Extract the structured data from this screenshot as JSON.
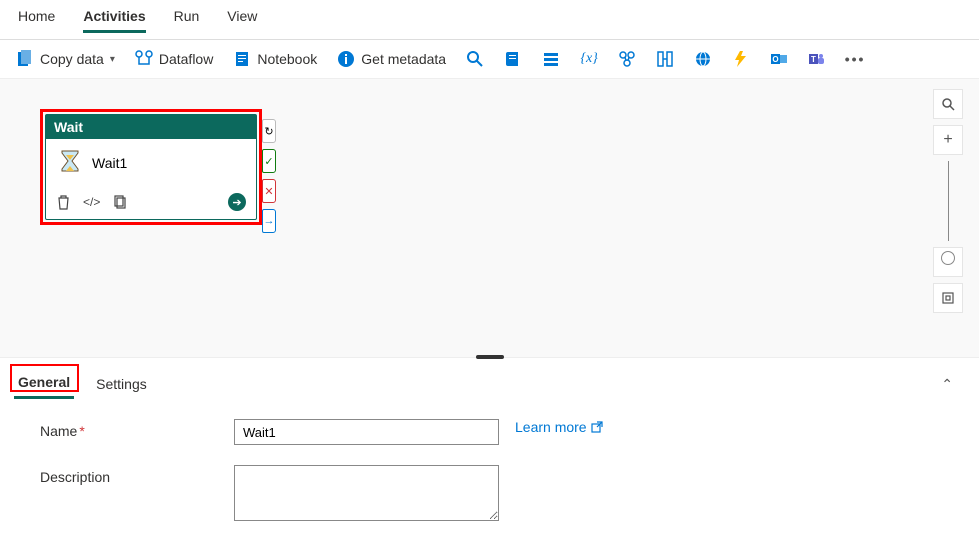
{
  "topnav": {
    "items": [
      {
        "label": "Home"
      },
      {
        "label": "Activities"
      },
      {
        "label": "Run"
      },
      {
        "label": "View"
      }
    ],
    "activeIndex": 1
  },
  "toolbar": {
    "copy_data": "Copy data",
    "dataflow": "Dataflow",
    "notebook": "Notebook",
    "get_metadata": "Get metadata"
  },
  "toolbar_icons": [
    "search-icon",
    "script-icon",
    "list-icon",
    "variable-icon",
    "web-icon",
    "column-transform-icon",
    "globe-icon",
    "azure-function-icon",
    "outlook-icon",
    "teams-icon",
    "more-icon"
  ],
  "activity": {
    "type_label": "Wait",
    "name": "Wait1",
    "handles": {
      "retry": "↻",
      "success": "✓",
      "failure": "✕",
      "skip": "→"
    }
  },
  "panel": {
    "tabs": [
      {
        "label": "General"
      },
      {
        "label": "Settings"
      }
    ],
    "activeIndex": 0
  },
  "general": {
    "name_label": "Name",
    "name_value": "Wait1",
    "description_label": "Description",
    "description_value": "",
    "learn_more": "Learn more"
  }
}
